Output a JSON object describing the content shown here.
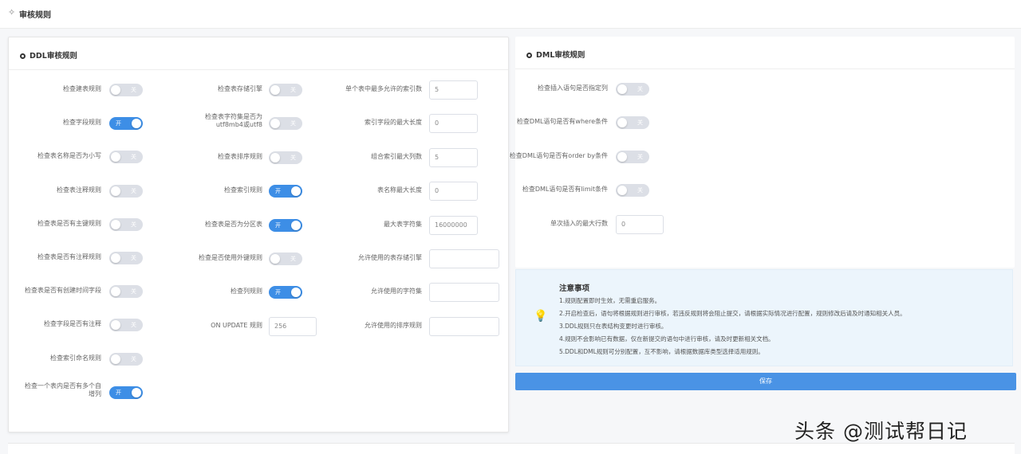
{
  "header": {
    "title": "审核规则"
  },
  "ddl": {
    "title": "DDL审核规则",
    "col1": [
      {
        "label": "检查建表规则",
        "on": false,
        "text": "关"
      },
      {
        "label": "检查字段规则",
        "on": true,
        "text": "开"
      },
      {
        "label": "检查表名称是否为小写",
        "on": false,
        "text": "关"
      },
      {
        "label": "检查表注释规则",
        "on": false,
        "text": "关"
      },
      {
        "label": "检查表是否有主键规则",
        "on": false,
        "text": "关"
      },
      {
        "label": "检查表是否有注释规则",
        "on": false,
        "text": "关"
      },
      {
        "label": "检查表是否有创建时间字段",
        "on": false,
        "text": "关"
      },
      {
        "label": "检查字段是否有注释",
        "on": false,
        "text": "关"
      },
      {
        "label": "检查索引命名规则",
        "on": false,
        "text": "关"
      },
      {
        "label": "检查一个表内是否有多个自增列",
        "on": true,
        "text": "开"
      }
    ],
    "col2": [
      {
        "label": "检查表存储引擎",
        "type": "switch",
        "on": false,
        "text": "关"
      },
      {
        "label": "检查表字符集是否为utf8mb4或utf8",
        "type": "switch",
        "on": false,
        "text": "关"
      },
      {
        "label": "检查表排序规则",
        "type": "switch",
        "on": false,
        "text": "关"
      },
      {
        "label": "检查索引规则",
        "type": "switch",
        "on": true,
        "text": "开"
      },
      {
        "label": "检查表是否为分区表",
        "type": "switch",
        "on": true,
        "text": "开"
      },
      {
        "label": "检查是否使用外键规则",
        "type": "switch",
        "on": false,
        "text": "关"
      },
      {
        "label": "检查列规则",
        "type": "switch",
        "on": true,
        "text": "开"
      },
      {
        "label": "ON UPDATE 规则",
        "type": "input",
        "value": "256"
      }
    ],
    "col3": [
      {
        "label": "单个表中最多允许的索引数",
        "value": "5"
      },
      {
        "label": "索引字段的最大长度",
        "value": "0"
      },
      {
        "label": "组合索引最大列数",
        "value": "5"
      },
      {
        "label": "表名称最大长度",
        "value": "0"
      },
      {
        "label": "最大表字符集",
        "value": "16000000"
      },
      {
        "label": "允许使用的表存储引擎",
        "value": ""
      },
      {
        "label": "允许使用的字符集",
        "value": ""
      },
      {
        "label": "允许使用的排序规则",
        "value": ""
      }
    ]
  },
  "dml": {
    "title": "DML审核规则",
    "rows": [
      {
        "label": "检查插入语句是否指定列",
        "type": "switch",
        "on": false,
        "text": "关"
      },
      {
        "label": "检查DML语句是否有where条件",
        "type": "switch",
        "on": false,
        "text": "关"
      },
      {
        "label": "检查DML语句是否有order by条件",
        "type": "switch",
        "on": false,
        "text": "关"
      },
      {
        "label": "检查DML语句是否有limit条件",
        "type": "switch",
        "on": false,
        "text": "关"
      },
      {
        "label": "单次插入的最大行数",
        "type": "input",
        "value": "0"
      }
    ]
  },
  "tips": {
    "title": "注意事项",
    "lines": [
      "1.规则配置即时生效，无需重启服务。",
      "2.开启检查后，语句将根据规则进行审核，若违反规则将会阻止提交，请根据实际情况进行配置，规则修改后请及时通知相关人员。",
      "3.DDL规则只在表结构变更时进行审核。",
      "4.规则不会影响已有数据，仅在新提交的语句中进行审核，请及时更新相关文档。",
      "5.DDL和DML规则可分别配置，互不影响，请根据数据库类型选择适用规则。"
    ]
  },
  "save_label": "保存",
  "watermark": "头条 @测试帮日记",
  "colors": {
    "accent": "#3d8ee6",
    "switch_off": "#dcdfe6",
    "tips_bg": "#ecf5fc"
  }
}
